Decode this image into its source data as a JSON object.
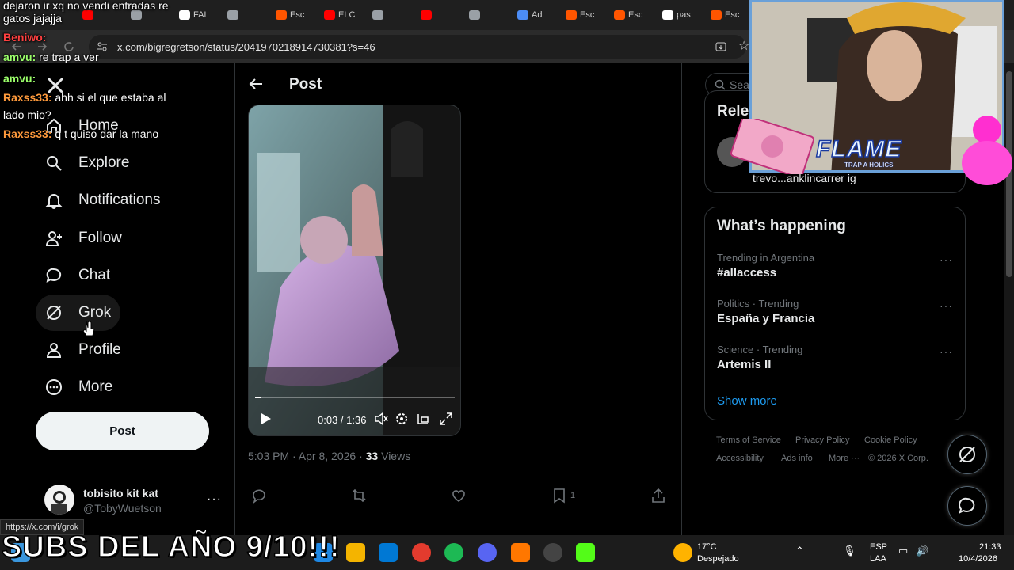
{
  "browser": {
    "tabs": [
      {
        "label": "",
        "color": "#ff0000"
      },
      {
        "label": "",
        "color": "#9aa0a6"
      },
      {
        "label": "FAL",
        "color": "#ffffff"
      },
      {
        "label": "",
        "color": "#9aa0a6"
      },
      {
        "label": "Esc",
        "color": "#ff5500"
      },
      {
        "label": "ELC",
        "color": "#ff0000"
      },
      {
        "label": "",
        "color": "#9aa0a6"
      },
      {
        "label": "",
        "color": "#ff0000"
      },
      {
        "label": "",
        "color": "#9aa0a6"
      },
      {
        "label": "Ad",
        "color": "#4c8df6"
      },
      {
        "label": "Esc",
        "color": "#ff5500"
      },
      {
        "label": "Esc",
        "color": "#ff5500"
      },
      {
        "label": "pas",
        "color": "#ffffff"
      },
      {
        "label": "Esc",
        "color": "#ff5500"
      },
      {
        "label": "",
        "color": "#ff0000"
      },
      {
        "label": "",
        "color": "#9aa0a6"
      },
      {
        "label": "",
        "color": "#ff0000"
      }
    ],
    "url": "x.com/bigregretson/status/2041970218914730381?s=46"
  },
  "nav": {
    "items": [
      {
        "label": "Home",
        "icon": "home-icon"
      },
      {
        "label": "Explore",
        "icon": "search-icon"
      },
      {
        "label": "Notifications",
        "icon": "bell-icon"
      },
      {
        "label": "Follow",
        "icon": "follow-icon"
      },
      {
        "label": "Chat",
        "icon": "chat-icon"
      },
      {
        "label": "Grok",
        "icon": "grok-icon"
      },
      {
        "label": "Profile",
        "icon": "person-icon"
      },
      {
        "label": "More",
        "icon": "more-circle-icon"
      }
    ],
    "post_label": "Post"
  },
  "account": {
    "name": "tobisito kit kat",
    "handle": "@TobyWuetson",
    "more": "···"
  },
  "post": {
    "header_title": "Post",
    "video": {
      "time": "0:03 / 1:36",
      "progress": 0.031
    },
    "time": "5:03 PM · Apr 8, 2026 · ",
    "views_count": "33",
    "views_label": " Views",
    "bookmark_count": "1"
  },
  "sidebar": {
    "search_placeholder": "Sea",
    "relevant_title": "Rele",
    "relevant_handle": "trevo...anklincarrer ig",
    "trends_title": "What’s happening",
    "trends": [
      {
        "context": "Trending in Argentina",
        "name": "#allaccess"
      },
      {
        "context": "Politics · Trending",
        "name": "España y Francia"
      },
      {
        "context": "Science · Trending",
        "name": "Artemis II"
      }
    ],
    "show_more": "Show more",
    "footer": {
      "terms": "Terms of Service",
      "privacy": "Privacy Policy",
      "cookie": "Cookie Policy",
      "accessibility": "Accessibility",
      "ads": "Ads info",
      "more": "More ···",
      "copyright": "© 2026 X Corp."
    }
  },
  "status_url": "https://x.com/i/grok",
  "chat": {
    "lines": [
      {
        "user": "",
        "text": "dejaron ir xq no vendi entradas re"
      },
      {
        "user": "",
        "text": "gatos jajajja"
      },
      {
        "user": "Beniwo:",
        "text": ""
      },
      {
        "user": "amvu:",
        "text": " re trap a ver"
      },
      {
        "user": "amvu:",
        "text": ""
      },
      {
        "user": "Raxss33:",
        "text": " ahh si el que estaba al"
      },
      {
        "user": "",
        "text": "lado mio?"
      },
      {
        "user": "Raxss33:",
        "text": " q t quiso dar la mano"
      }
    ]
  },
  "overlay": {
    "flame": "FLAME",
    "flame_sub": "TRAP A HOLICS",
    "banner": "SUBS DEL AÑO 9/10!!!"
  },
  "taskbar": {
    "weather_temp": "17°C",
    "weather_desc": "Despejado",
    "lang": "ESP",
    "lang_sub": "LAA",
    "time": "21:33",
    "date": "10/4/2026"
  },
  "colors": {
    "accent": "#1d9bf0",
    "bg": "#000000",
    "border": "#2f3336",
    "muted": "#71767b"
  }
}
